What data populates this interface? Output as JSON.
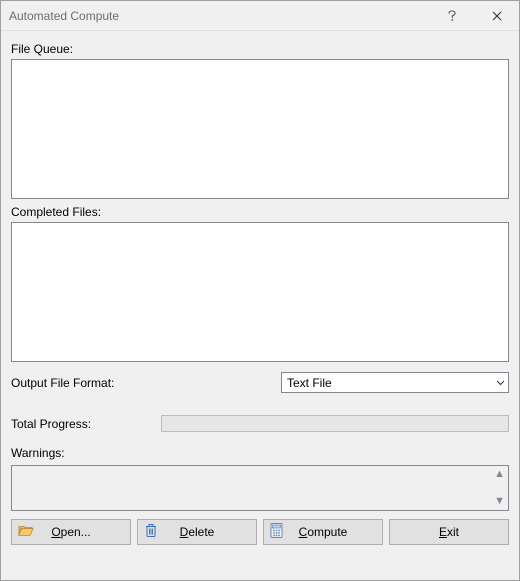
{
  "titlebar": {
    "title": "Automated Compute"
  },
  "labels": {
    "file_queue": "File Queue:",
    "completed_files": "Completed Files:",
    "output_format": "Output File Format:",
    "total_progress": "Total Progress:",
    "warnings": "Warnings:"
  },
  "output_format": {
    "selected": "Text File"
  },
  "buttons": {
    "open": "Open...",
    "delete": "Delete",
    "compute": "Compute",
    "exit": "Exit"
  }
}
